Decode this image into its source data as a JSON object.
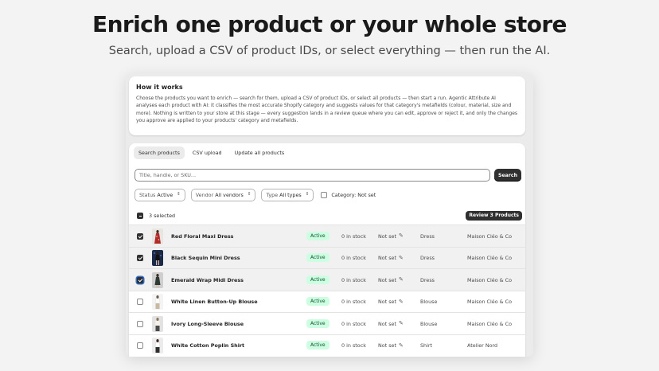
{
  "hero": {
    "title": "Enrich one product or your whole store",
    "subtitle": "Search, upload a CSV of product IDs, or select everything — then run the AI."
  },
  "info": {
    "title": "How it works",
    "body": "Choose the products you want to enrich — search for them, upload a CSV of product IDs, or select all products — then start a run. Agentic Attribute AI analyses each product with AI: it classifies the most accurate Shopify category and suggests values for that category's metafields (colour, material, size and more). Nothing is written to your store at this stage — every suggestion lands in a review queue where you can edit, approve or reject it, and only the changes you approve are applied to your products' category and metafields."
  },
  "tabs": [
    {
      "label": "Search products",
      "active": true
    },
    {
      "label": "CSV upload",
      "active": false
    },
    {
      "label": "Update all products",
      "active": false
    }
  ],
  "search": {
    "placeholder": "Title, handle, or SKU...",
    "button_label": "Search"
  },
  "filters": {
    "status": {
      "label": "Status",
      "value": "Active"
    },
    "vendor": {
      "label": "Vendor",
      "value": "All vendors"
    },
    "type": {
      "label": "Type",
      "value": "All types"
    },
    "category_label": "Category: Not set"
  },
  "selection": {
    "count_text": "3 selected",
    "review_label": "Review 3 Products"
  },
  "products": [
    {
      "name": "Red Floral Maxi Dress",
      "status": "Active",
      "stock": "0 in stock",
      "category": "Not set",
      "type": "Dress",
      "vendor": "Maison Cléo & Co",
      "selected": true
    },
    {
      "name": "Black Sequin Mini Dress",
      "status": "Active",
      "stock": "0 in stock",
      "category": "Not set",
      "type": "Dress",
      "vendor": "Maison Cléo & Co",
      "selected": true
    },
    {
      "name": "Emerald Wrap Midi Dress",
      "status": "Active",
      "stock": "0 in stock",
      "category": "Not set",
      "type": "Dress",
      "vendor": "Maison Cléo & Co",
      "selected": true
    },
    {
      "name": "White Linen Button-Up Blouse",
      "status": "Active",
      "stock": "0 in stock",
      "category": "Not set",
      "type": "Blouse",
      "vendor": "Maison Cléo & Co",
      "selected": false
    },
    {
      "name": "Ivory Long-Sleeve Blouse",
      "status": "Active",
      "stock": "0 in stock",
      "category": "Not set",
      "type": "Blouse",
      "vendor": "Maison Cléo & Co",
      "selected": false
    },
    {
      "name": "White Cotton Poplin Shirt",
      "status": "Active",
      "stock": "0 in stock",
      "category": "Not set",
      "type": "Shirt",
      "vendor": "Atelier Nord",
      "selected": false
    }
  ]
}
